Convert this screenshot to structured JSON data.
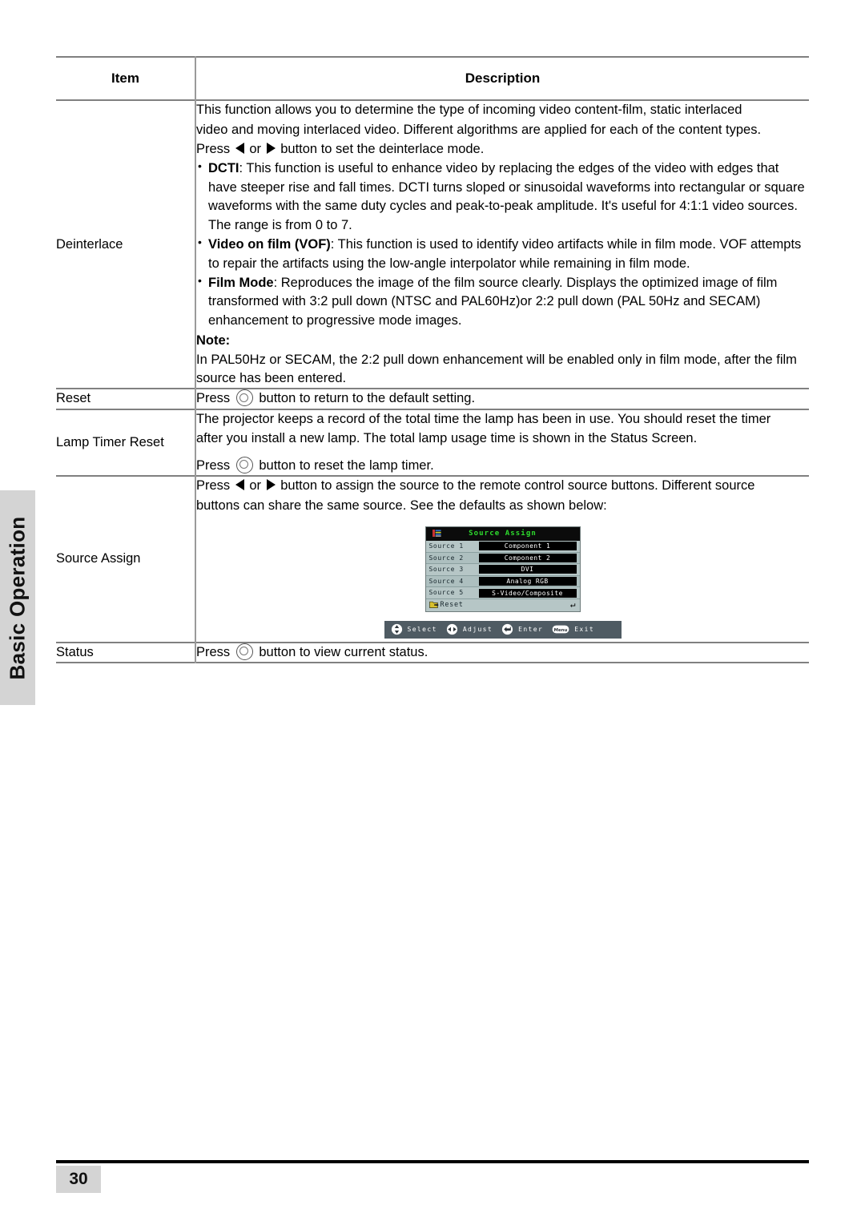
{
  "side_tab": {
    "label": "Basic Operation"
  },
  "footer": {
    "page_number": "30"
  },
  "table": {
    "headers": {
      "item": "Item",
      "description": "Description"
    },
    "rows": [
      {
        "item": "Deinterlace",
        "intro_line_1": "This function allows you to determine the type of incoming video content-film, static interlaced",
        "intro_line_2": "video and moving interlaced video. Different algorithms are applied for each of the content types.",
        "intro_press_prefix": "Press",
        "intro_press_mid": "or",
        "intro_press_suffix": "button to set the deinterlace mode.",
        "bullets": [
          {
            "term": "DCTI",
            "text": ": This function is useful to enhance video by replacing the edges of the video with edges that have steeper rise and fall times. DCTI turns sloped or sinusoidal waveforms into rectangular or square waveforms with the same duty cycles and peak-to-peak amplitude. It's useful for 4:1:1 video sources. The range is from 0 to 7."
          },
          {
            "term": "Video on film (VOF)",
            "text": ": This function is used to identify video artifacts while in film mode. VOF attempts to repair the artifacts using the low-angle interpolator while remaining in film mode."
          },
          {
            "term": "Film Mode",
            "text": ": Reproduces the image of the film source clearly. Displays the optimized image of film transformed with 3:2 pull down (NTSC and PAL60Hz)or 2:2 pull down (PAL 50Hz and SECAM) enhancement to progressive mode images."
          }
        ],
        "note_label": "Note:",
        "note_text": "In PAL50Hz or SECAM, the 2:2 pull down enhancement will be enabled only in film mode, after the film source has been entered."
      },
      {
        "item": "Reset",
        "press_prefix": "Press",
        "press_suffix": "button to return to the default setting."
      },
      {
        "item": "Lamp Timer Reset",
        "line_1": "The projector keeps a record of the total time the lamp has been in use. You should reset the timer",
        "line_2": "after you install a new lamp. The total lamp usage time is shown in the Status Screen.",
        "press_prefix": "Press",
        "press_suffix": "button to reset the lamp timer."
      },
      {
        "item": "Source Assign",
        "intro_prefix": "Press",
        "intro_mid": "or",
        "intro_suffix": "button to assign the source to the remote control source buttons. Different source",
        "intro_line_2": "buttons can share the same source. See the defaults as shown below:"
      },
      {
        "item": "Status",
        "press_prefix": "Press",
        "press_suffix": "button to view current status."
      }
    ]
  },
  "osd": {
    "title": "Source Assign",
    "rows": [
      {
        "label": "Source 1",
        "value": "Component 1"
      },
      {
        "label": "Source 2",
        "value": "Component 2"
      },
      {
        "label": "Source 3",
        "value": "DVI"
      },
      {
        "label": "Source 4",
        "value": "Analog RGB"
      },
      {
        "label": "Source 5",
        "value": "S-Video/Composite"
      }
    ],
    "reset_label": "Reset",
    "hints": [
      {
        "icon": "up-down-arrows-icon",
        "label": "Select"
      },
      {
        "icon": "left-right-arrows-icon",
        "label": "Adjust"
      },
      {
        "icon": "enter-arrow-icon",
        "label": "Enter"
      },
      {
        "icon": "menu-button-icon",
        "label": "Exit"
      }
    ],
    "menu_button_text": "Menu"
  },
  "colors": {
    "osd_title_green": "#2ddd2d",
    "osd_panel": "#b6c6c6",
    "osd_value_bg": "#000000",
    "hint_bar": "#4f5b63",
    "side_tab_gray": "#d4d4d4"
  }
}
